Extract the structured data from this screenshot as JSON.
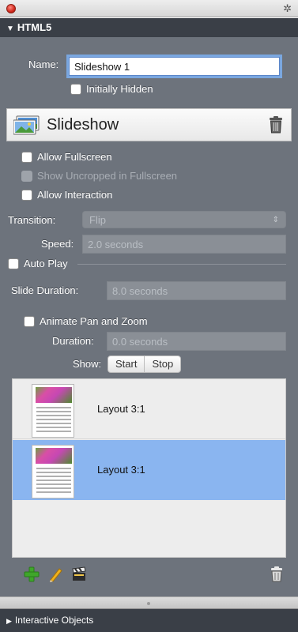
{
  "window": {
    "close_icon": "close-icon",
    "gear_icon": "gear-icon",
    "gear_glyph": "✲"
  },
  "section": {
    "title": "HTML5",
    "toggle_glyph": "▼"
  },
  "name_field": {
    "label": "Name:",
    "value": "Slideshow 1"
  },
  "initially_hidden": {
    "label": "Initially Hidden",
    "checked": false
  },
  "widget": {
    "title": "Slideshow"
  },
  "options": {
    "allow_fullscreen": {
      "label": "Allow Fullscreen",
      "checked": false
    },
    "show_uncropped": {
      "label": "Show Uncropped in Fullscreen",
      "checked": false,
      "enabled": false
    },
    "allow_interaction": {
      "label": "Allow Interaction",
      "checked": false
    }
  },
  "transition": {
    "label": "Transition:",
    "value": "Flip",
    "arrows": "⇕"
  },
  "speed": {
    "label": "Speed:",
    "value": "2.0 seconds"
  },
  "auto_play": {
    "label": "Auto Play",
    "checked": false
  },
  "slide_duration": {
    "label": "Slide Duration:",
    "value": "8.0 seconds"
  },
  "animate_pan_zoom": {
    "label": "Animate Pan and Zoom",
    "checked": false
  },
  "duration": {
    "label": "Duration:",
    "value": "0.0 seconds"
  },
  "show": {
    "label": "Show:",
    "options": [
      "Start",
      "Stop"
    ]
  },
  "slides": [
    {
      "label": "Layout 3:1",
      "selected": false
    },
    {
      "label": "Layout 3:1",
      "selected": true
    }
  ],
  "toolbar": {
    "add_icon": "plus-icon",
    "edit_icon": "pencil-icon",
    "clapper_icon": "clapperboard-icon",
    "delete_icon": "trash-icon"
  },
  "footer": {
    "title": "Interactive Objects",
    "toggle_glyph": "▶"
  },
  "colors": {
    "panel": "#6d737c",
    "header": "#3a3f47",
    "selection": "#8ab5f0",
    "focus": "#7aa7e0",
    "add": "#3fa62a"
  }
}
